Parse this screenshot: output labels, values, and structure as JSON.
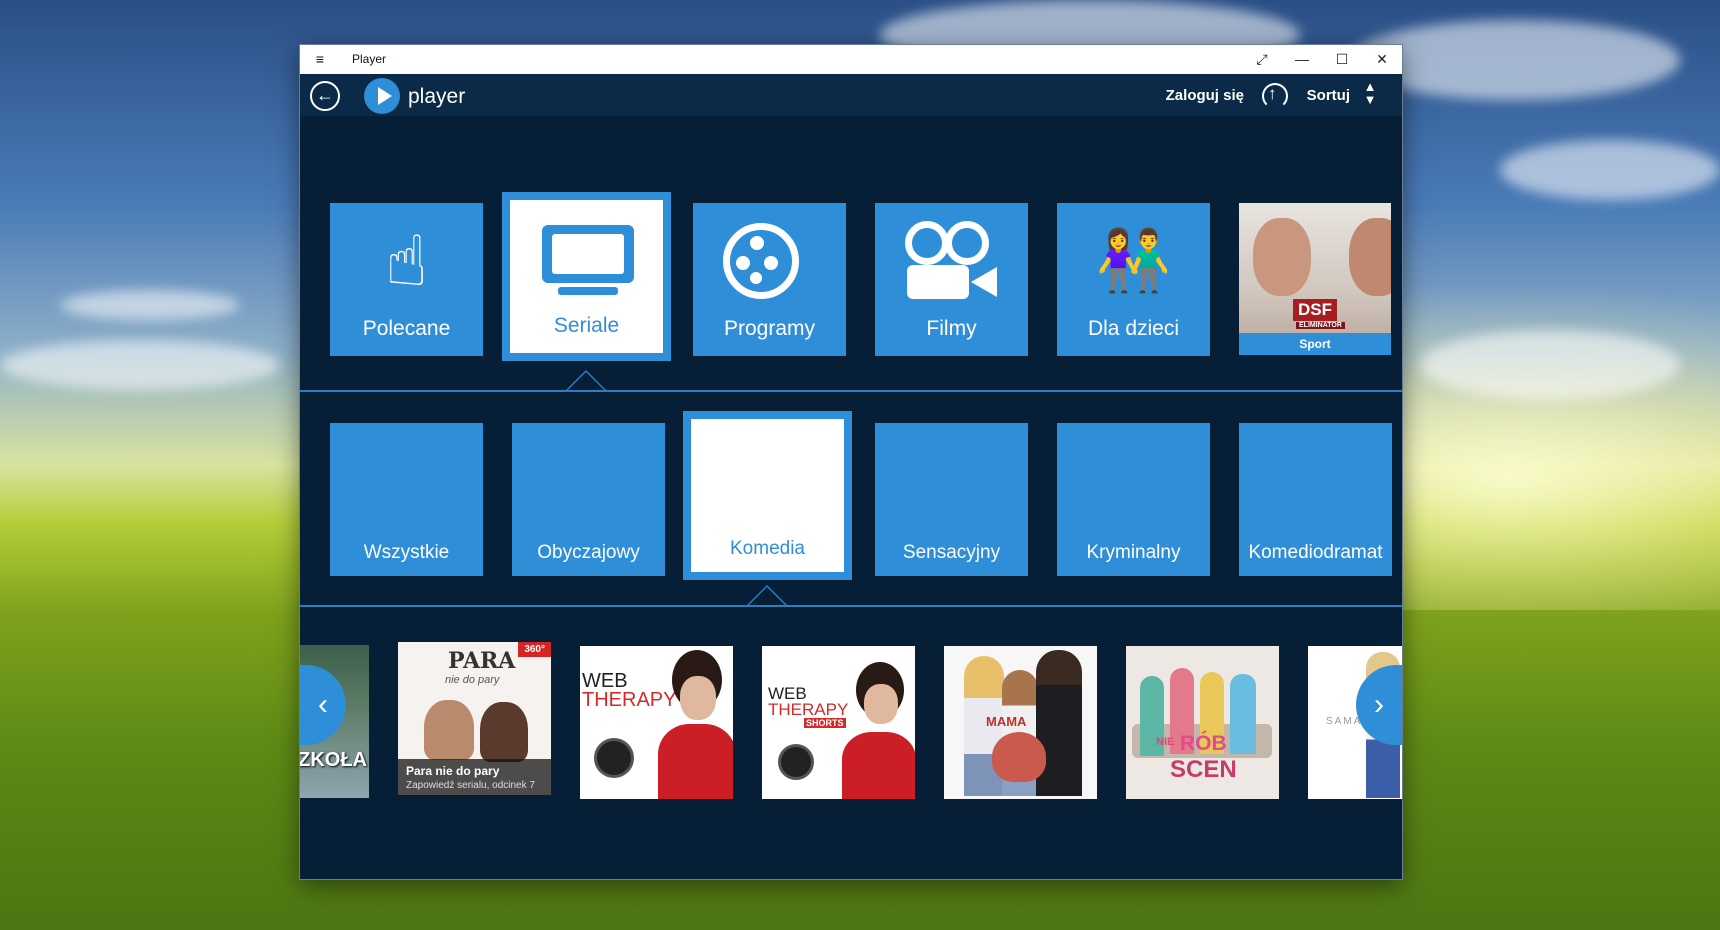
{
  "window": {
    "title": "Player",
    "controls": {
      "expand": "⤢",
      "minimize": "—",
      "maximize": "☐",
      "close": "✕"
    }
  },
  "appbar": {
    "logo_text": "player",
    "login_label": "Zaloguj się",
    "sort_label": "Sortuj"
  },
  "categories": [
    {
      "label": "Polecane",
      "icon": "pointing-hand-icon"
    },
    {
      "label": "Seriale",
      "icon": "tv-icon",
      "selected": true
    },
    {
      "label": "Programy",
      "icon": "film-reel-icon"
    },
    {
      "label": "Filmy",
      "icon": "video-camera-icon"
    },
    {
      "label": "Dla dzieci",
      "icon": "children-icon"
    },
    {
      "label": "Sport",
      "badge": "DSF",
      "badge_sub": "ELIMINATOR"
    }
  ],
  "subcategories": [
    {
      "label": "Wszystkie"
    },
    {
      "label": "Obyczajowy"
    },
    {
      "label": "Komedia",
      "selected": true
    },
    {
      "label": "Sensacyjny"
    },
    {
      "label": "Kryminalny"
    },
    {
      "label": "Komediodramat"
    }
  ],
  "thumbnails": [
    {
      "text": "SZKOŁA"
    },
    {
      "title": "PARA",
      "subtitle": "nie do pary",
      "badge": "360°",
      "caption_title": "Para nie do pary",
      "caption_sub": "Zapowiedź serialu, odcinek 7"
    },
    {
      "line1": "WEB",
      "line2": "THERAPY"
    },
    {
      "line1": "WEB",
      "line2": "THERAPY",
      "line3": "SHORTS"
    },
    {
      "text": "MAMA"
    },
    {
      "line1": "NIE",
      "line2": "RÓB",
      "line3": "SCEN"
    },
    {
      "text": "SAMA"
    }
  ],
  "colors": {
    "accent": "#2f8ed8",
    "background": "#061f36",
    "appbar": "#0a2a47"
  }
}
